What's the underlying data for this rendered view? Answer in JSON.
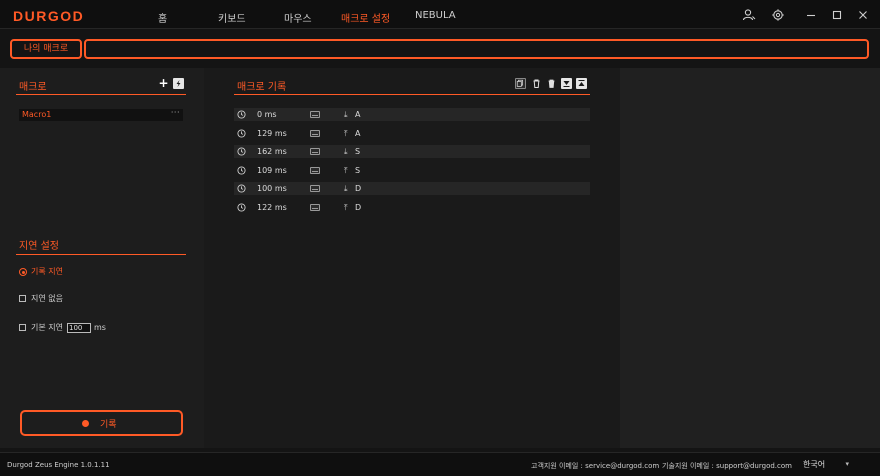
{
  "brand": "DURGOD",
  "nav": {
    "home": "홈",
    "keyboard": "키보드",
    "mouse": "마우스",
    "macro_settings": "매크로 설정",
    "nebula": "NEBULA"
  },
  "window_controls": {
    "user_icon": "user-icon",
    "settings_icon": "gear-icon",
    "minimize_icon": "minimize-icon",
    "maximize_icon": "maximize-icon",
    "close_icon": "close-icon"
  },
  "macro_bar": {
    "my_macro_label": "나의 매크로",
    "macro_name_value": ""
  },
  "macro_list": {
    "title": "매크로",
    "add_symbol": "+",
    "items": [
      {
        "name": "Macro1",
        "more": "···"
      }
    ]
  },
  "delay_settings": {
    "title": "지연 설정",
    "options": {
      "record_delay": "기록 지연",
      "no_delay": "지연 없음",
      "default_delay": "기본 지연"
    },
    "default_delay_value": "100",
    "unit": "ms",
    "selected": "record_delay"
  },
  "record_button": {
    "label": "기록"
  },
  "macro_record": {
    "title": "매크로 기록",
    "rows": [
      {
        "time": "0 ms",
        "direction": "down",
        "key": "A"
      },
      {
        "time": "129 ms",
        "direction": "up",
        "key": "A"
      },
      {
        "time": "162 ms",
        "direction": "down",
        "key": "S"
      },
      {
        "time": "109 ms",
        "direction": "up",
        "key": "S"
      },
      {
        "time": "100 ms",
        "direction": "down",
        "key": "D"
      },
      {
        "time": "122 ms",
        "direction": "up",
        "key": "D"
      }
    ]
  },
  "status_bar": {
    "version": "Durgod Zeus Engine 1.0.1.11",
    "customer_email": "고객지원 이메일 : service@durgod.com",
    "tech_email": "기술지원 이메일 : support@durgod.com",
    "language": "한국어"
  },
  "colors": {
    "accent": "#ff5a26",
    "background": "#141414",
    "panel": "#1d1d1d",
    "row_alt": "#262626"
  }
}
